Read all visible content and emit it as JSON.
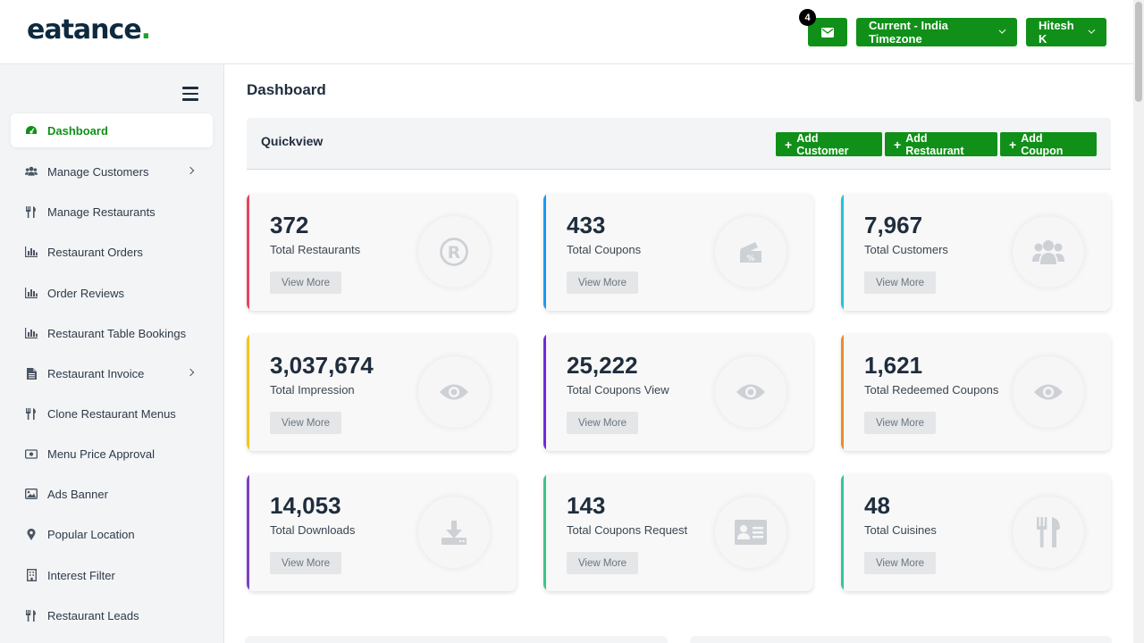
{
  "brand": {
    "name": "eatance",
    "dot": "."
  },
  "header": {
    "mail_badge": "4",
    "timezone_label": "Current - India Timezone",
    "user_label": "Hitesh K"
  },
  "sidebar": {
    "items": [
      {
        "label": "Dashboard",
        "icon": "dashboard-icon"
      },
      {
        "label": "Manage Customers",
        "icon": "users-icon"
      },
      {
        "label": "Manage Restaurants",
        "icon": "utensils-icon"
      },
      {
        "label": "Restaurant Orders",
        "icon": "bar-chart-icon"
      },
      {
        "label": "Order Reviews",
        "icon": "bar-chart-icon"
      },
      {
        "label": "Restaurant Table Bookings",
        "icon": "bar-chart-icon"
      },
      {
        "label": "Restaurant Invoice",
        "icon": "file-icon"
      },
      {
        "label": "Clone Restaurant Menus",
        "icon": "utensils-icon"
      },
      {
        "label": "Menu Price Approval",
        "icon": "money-icon"
      },
      {
        "label": "Ads Banner",
        "icon": "image-icon"
      },
      {
        "label": "Popular Location",
        "icon": "map-pin-icon"
      },
      {
        "label": "Interest Filter",
        "icon": "building-icon"
      },
      {
        "label": "Restaurant Leads",
        "icon": "utensils-icon"
      }
    ]
  },
  "main": {
    "title": "Dashboard",
    "quickview": {
      "title": "Quickview",
      "add_customer": "Add Customer",
      "add_restaurant": "Add Restaurant",
      "add_coupon": "Add Coupon"
    },
    "view_more": "View More",
    "cards": [
      {
        "value": "372",
        "label": "Total Restaurants",
        "accent": "#e8455f",
        "icon": "registered-icon"
      },
      {
        "value": "433",
        "label": "Total Coupons",
        "accent": "#1b9af0",
        "icon": "coupon-icon"
      },
      {
        "value": "7,967",
        "label": "Total Customers",
        "accent": "#23c3d8",
        "icon": "users-icon"
      },
      {
        "value": "3,037,674",
        "label": "Total Impression",
        "accent": "#f5c518",
        "icon": "eye-icon"
      },
      {
        "value": "25,222",
        "label": "Total Coupons View",
        "accent": "#6f2bd9",
        "icon": "eye-icon"
      },
      {
        "value": "1,621",
        "label": "Total Redeemed Coupons",
        "accent": "#f08a2a",
        "icon": "eye-icon"
      },
      {
        "value": "14,053",
        "label": "Total Downloads",
        "accent": "#7b3fc8",
        "icon": "download-icon"
      },
      {
        "value": "143",
        "label": "Total Coupons Request",
        "accent": "#3ec48a",
        "icon": "id-card-icon"
      },
      {
        "value": "48",
        "label": "Total Cuisines",
        "accent": "#2fc79c",
        "icon": "utensils-icon"
      }
    ]
  },
  "colors": {
    "primary": "#109018",
    "brand_dark": "#0d2a3f"
  }
}
